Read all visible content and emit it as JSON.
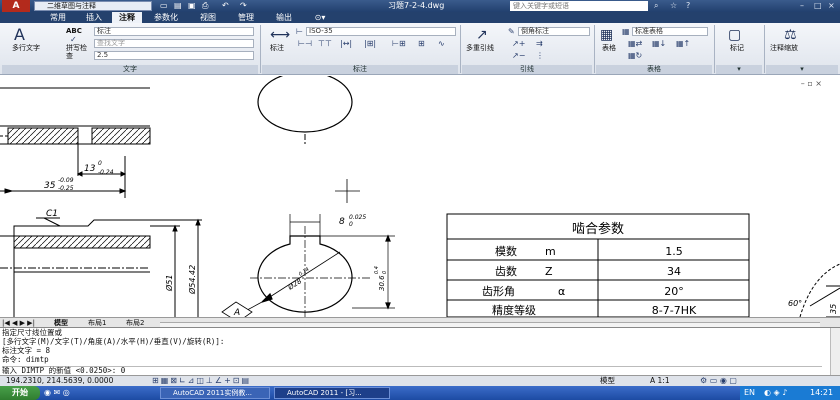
{
  "titlebar": {
    "logo": "A",
    "workspace": "二维草图与注释",
    "doc_title": "习题7-2-4.dwg",
    "search_placeholder": "键入关键字或短语"
  },
  "tabs": [
    "常用",
    "插入",
    "注释",
    "参数化",
    "视图",
    "管理",
    "输出"
  ],
  "ribbon": {
    "text_panel": {
      "mtext_label": "多行文字",
      "spell_label": "拼写检查",
      "abc": "ABC",
      "style_value": "标注",
      "find_placeholder": "查找文字",
      "height_value": "2.5",
      "title": "文字"
    },
    "dim_panel": {
      "dim_label": "标注",
      "dimstyle_value": "ISO-35",
      "title": "标注"
    },
    "leader_panel": {
      "multileader_label": "多重引线",
      "style_value": "倒角标注",
      "title": "引线"
    },
    "table_panel": {
      "table_label": "表格",
      "style_value": "标准表格",
      "title": "表格"
    },
    "markup_panel": {
      "label": "标记"
    },
    "scale_panel": {
      "label": "注释缩放"
    }
  },
  "drawing": {
    "dims": {
      "d1": "13",
      "d1_tol": "-0.24",
      "d1_up": "0",
      "d2": "35",
      "d2_up": "-0.09",
      "d2_low": "-0.25",
      "chamfer": "C1",
      "d51": "Ø51",
      "d54": "Ø54.42",
      "key": "8",
      "key_up": "0.025",
      "key_low": "0",
      "hole": "Ø28",
      "hole_up": "0.14",
      "hole_low": "0",
      "depth": "30.6",
      "depth_up": "0.4",
      "depth_low": "0",
      "datum": "A",
      "angle": "60°",
      "right_dim": "35"
    },
    "gear_table": {
      "title": "啮合参数",
      "rows": [
        {
          "name": "模数",
          "sym": "m",
          "value": "1.5"
        },
        {
          "name": "齿数",
          "sym": "Z",
          "value": "34"
        },
        {
          "name": "齿形角",
          "sym": "α",
          "value": "20°"
        },
        {
          "name": "精度等级",
          "sym": "",
          "value": "8-7-7HK"
        }
      ]
    }
  },
  "layout_tabs": [
    "模型",
    "布局1",
    "布局2"
  ],
  "command": {
    "lines": [
      "指定尺寸线位置或",
      "[多行文字(M)/文字(T)/角度(A)/水平(H)/垂直(V)/旋转(R)]:",
      "标注文字 = 8",
      "命令: dimtp"
    ],
    "prompt": "输入 DIMTP 的新值 <0.0250>: 0"
  },
  "status": {
    "coords": "194.2310, 214.5639, 0.0000",
    "model": "模型",
    "scale": "A 1:1"
  },
  "taskbar": {
    "start": "开始",
    "tasks": [
      "AutoCAD 2011实例教...",
      "AutoCAD 2011 - [习..."
    ],
    "lang": "EN",
    "clock": "14:21"
  }
}
